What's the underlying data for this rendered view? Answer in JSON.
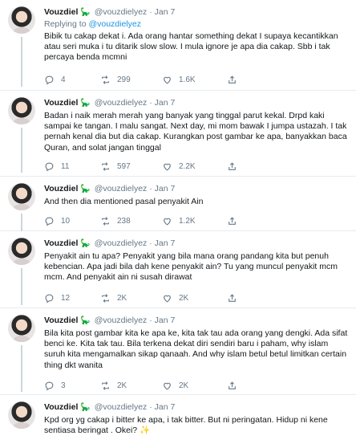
{
  "tweets": [
    {
      "name": "Vouzdiel",
      "emoji": "🦕",
      "handle": "@vouzdielyez",
      "date": "Jan 7",
      "reply_prefix": "Replying to",
      "reply_to": "@vouzdielyez",
      "text": "Bibik tu cakap dekat i. Ada orang hantar something dekat I supaya kecantikkan atau seri muka i tu ditarik slow slow. I mula ignore je apa dia cakap. Sbb i tak percaya benda mcmni",
      "replies": "4",
      "retweets": "299",
      "likes": "1.6K"
    },
    {
      "name": "Vouzdiel",
      "emoji": "🦕",
      "handle": "@vouzdielyez",
      "date": "Jan 7",
      "text": "Badan i naik merah merah yang banyak yang tinggal parut kekal. Drpd kaki sampai ke tangan. I malu sangat. Next day, mi mom bawak I jumpa ustazah. I tak pernah kenal dia but dia cakap. Kurangkan post gambar ke apa, banyakkan baca Quran, and solat jangan tinggal",
      "replies": "11",
      "retweets": "597",
      "likes": "2.2K"
    },
    {
      "name": "Vouzdiel",
      "emoji": "🦕",
      "handle": "@vouzdielyez",
      "date": "Jan 7",
      "text": "And then dia mentioned pasal penyakit Ain",
      "replies": "10",
      "retweets": "238",
      "likes": "1.2K"
    },
    {
      "name": "Vouzdiel",
      "emoji": "🦕",
      "handle": "@vouzdielyez",
      "date": "Jan 7",
      "text": "Penyakit ain tu apa? Penyakit yang bila mana orang pandang kita but penuh kebencian. Apa jadi bila dah kene penyakit ain? Tu yang muncul penyakit mcm mcm. And penyakit ain ni susah dirawat",
      "replies": "12",
      "retweets": "2K",
      "likes": "2K"
    },
    {
      "name": "Vouzdiel",
      "emoji": "🦕",
      "handle": "@vouzdielyez",
      "date": "Jan 7",
      "text": "Bila kita post gambar kita ke apa ke, kita tak tau ada orang yang dengki. Ada sifat benci ke. Kita tak tau. Bila terkena dekat diri sendiri baru i paham, why islam suruh kita mengamalkan sikap qanaah. And why islam betul betul limitkan certain thing dkt wanita",
      "replies": "3",
      "retweets": "2K",
      "likes": "2K"
    },
    {
      "name": "Vouzdiel",
      "emoji": "🦕",
      "handle": "@vouzdielyez",
      "date": "Jan 7",
      "text": "Kpd org yg cakap i bitter ke apa, i tak bitter. But ni peringatan. Hidup ni kene sentiasa beringat . Okei?",
      "sparkle": "✨"
    }
  ],
  "icons": {
    "reply": "reply-icon",
    "retweet": "retweet-icon",
    "like": "heart-icon",
    "share": "share-icon"
  },
  "colors": {
    "link": "#1b95e0",
    "muted": "#657786",
    "divider": "#e6ecf0"
  }
}
